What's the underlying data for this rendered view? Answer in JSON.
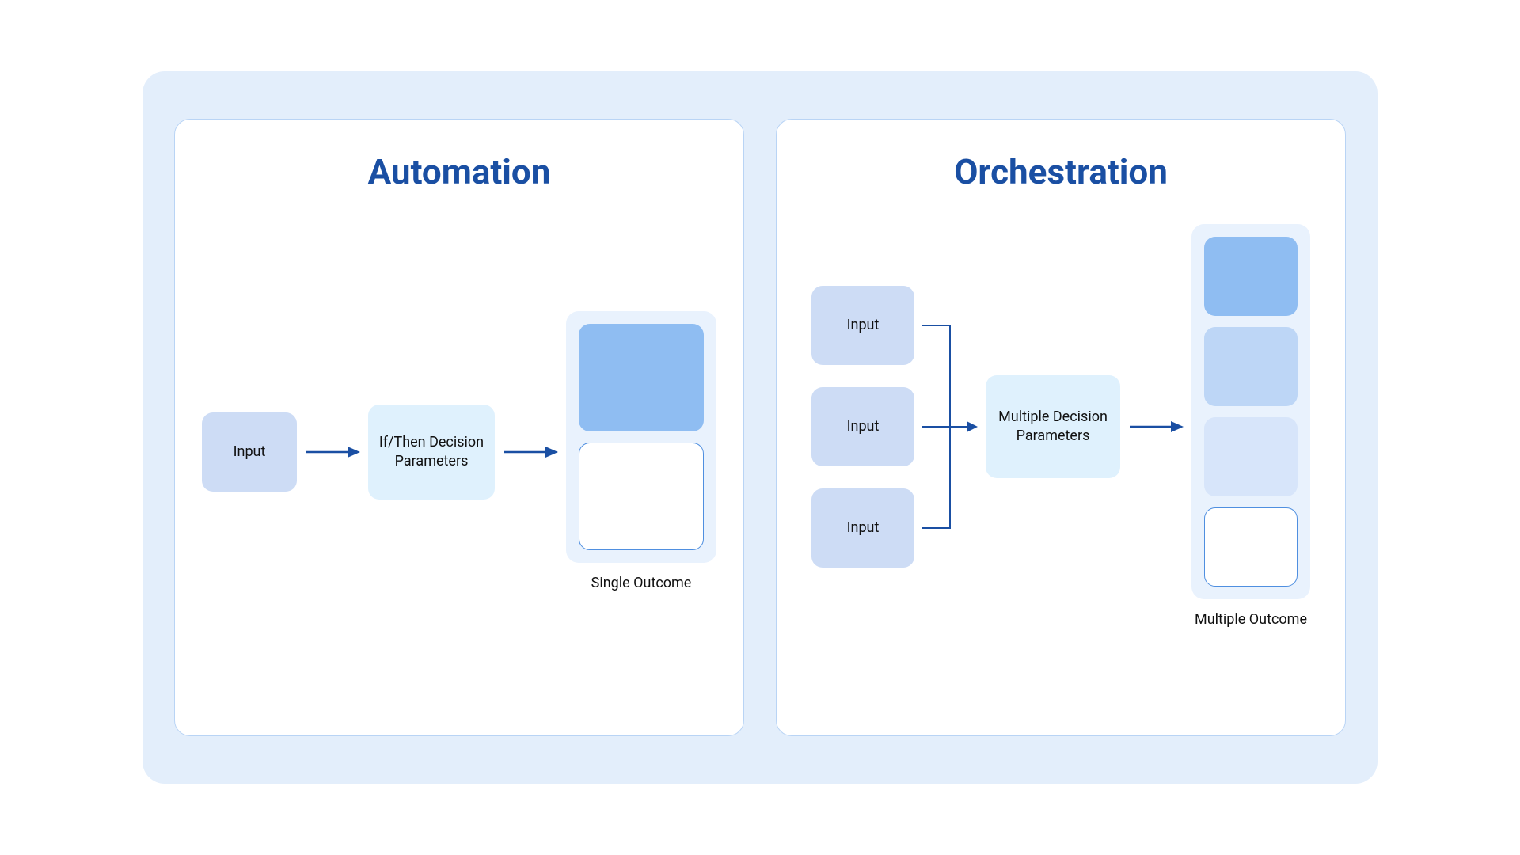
{
  "colors": {
    "canvas_bg": "#e3eefb",
    "panel_border": "#b9d4f5",
    "title": "#1a4fa3",
    "input_fill": "#cddcf5",
    "decision_fill": "#dff1fd",
    "outcome_bg": "#e9f2fd",
    "arrow": "#1a4fa3",
    "slot_strong": "#8fbdf2",
    "slot_med": "#bdd6f6",
    "slot_light": "#d7e5fa",
    "slot_outline_border": "#4f8fe0"
  },
  "automation": {
    "title": "Automation",
    "input_label": "Input",
    "decision_label": "If/Then Decision Parameters",
    "outcome_caption": "Single Outcome"
  },
  "orchestration": {
    "title": "Orchestration",
    "input_labels": [
      "Input",
      "Input",
      "Input"
    ],
    "decision_label": "Multiple Decision Parameters",
    "outcome_caption": "Multiple Outcome"
  }
}
